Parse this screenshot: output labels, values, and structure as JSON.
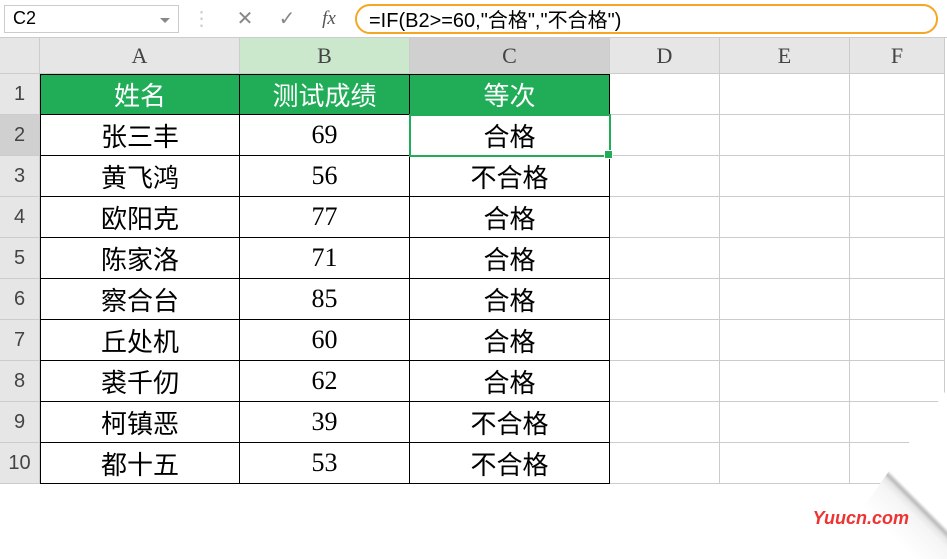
{
  "formula_bar": {
    "name_box": "C2",
    "cancel_symbol": "✕",
    "confirm_symbol": "✓",
    "fx_label": "fx",
    "formula": "=IF(B2>=60,\"合格\",\"不合格\")"
  },
  "columns": [
    "A",
    "B",
    "C",
    "D",
    "E",
    "F"
  ],
  "rows": [
    "1",
    "2",
    "3",
    "4",
    "5",
    "6",
    "7",
    "8",
    "9",
    "10"
  ],
  "headers": {
    "A": "姓名",
    "B": "测试成绩",
    "C": "等次"
  },
  "data": [
    {
      "name": "张三丰",
      "score": "69",
      "grade": "合格"
    },
    {
      "name": "黄飞鸿",
      "score": "56",
      "grade": "不合格"
    },
    {
      "name": "欧阳克",
      "score": "77",
      "grade": "合格"
    },
    {
      "name": "陈家洛",
      "score": "71",
      "grade": "合格"
    },
    {
      "name": "察合台",
      "score": "85",
      "grade": "合格"
    },
    {
      "name": "丘处机",
      "score": "60",
      "grade": "合格"
    },
    {
      "name": "裘千仞",
      "score": "62",
      "grade": "合格"
    },
    {
      "name": "柯镇恶",
      "score": "39",
      "grade": "不合格"
    },
    {
      "name": "都十五",
      "score": "53",
      "grade": "不合格"
    }
  ],
  "active_cell": "C2",
  "watermark": "Yuucn.com"
}
